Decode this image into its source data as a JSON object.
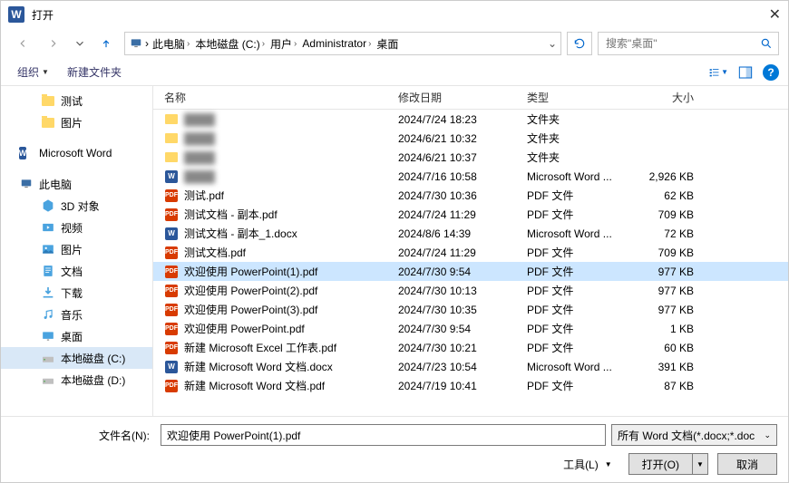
{
  "title": "打开",
  "breadcrumbs": [
    "此电脑",
    "本地磁盘 (C:)",
    "用户",
    "Administrator",
    "桌面"
  ],
  "search_placeholder": "搜索\"桌面\"",
  "toolbar": {
    "organize": "组织",
    "newfolder": "新建文件夹"
  },
  "nav": {
    "quick": [
      {
        "label": "测试",
        "icon": "folder"
      },
      {
        "label": "图片",
        "icon": "folder"
      }
    ],
    "word": "Microsoft Word",
    "thispc": "此电脑",
    "thispc_children": [
      {
        "label": "3D 对象",
        "icon": "3d"
      },
      {
        "label": "视频",
        "icon": "video"
      },
      {
        "label": "图片",
        "icon": "pictures"
      },
      {
        "label": "文档",
        "icon": "docs"
      },
      {
        "label": "下载",
        "icon": "downloads"
      },
      {
        "label": "音乐",
        "icon": "music"
      },
      {
        "label": "桌面",
        "icon": "desktop"
      }
    ],
    "drives": [
      {
        "label": "本地磁盘 (C:)",
        "selected": true
      },
      {
        "label": "本地磁盘 (D:)",
        "selected": false
      }
    ]
  },
  "columns": {
    "name": "名称",
    "date": "修改日期",
    "type": "类型",
    "size": "大小"
  },
  "files": [
    {
      "name": "",
      "date": "2024/7/24 18:23",
      "type": "文件夹",
      "size": "",
      "icon": "folder",
      "blurred": true
    },
    {
      "name": "",
      "date": "2024/6/21 10:32",
      "type": "文件夹",
      "size": "",
      "icon": "folder",
      "blurred": true
    },
    {
      "name": "",
      "date": "2024/6/21 10:37",
      "type": "文件夹",
      "size": "",
      "icon": "folder",
      "blurred": true
    },
    {
      "name": "",
      "date": "2024/7/16 10:58",
      "type": "Microsoft Word ...",
      "size": "2,926 KB",
      "icon": "docx",
      "blurred": true
    },
    {
      "name": "测试.pdf",
      "date": "2024/7/30 10:36",
      "type": "PDF 文件",
      "size": "62 KB",
      "icon": "pdf"
    },
    {
      "name": "测试文档 - 副本.pdf",
      "date": "2024/7/24 11:29",
      "type": "PDF 文件",
      "size": "709 KB",
      "icon": "pdf"
    },
    {
      "name": "测试文档 - 副本_1.docx",
      "date": "2024/8/6 14:39",
      "type": "Microsoft Word ...",
      "size": "72 KB",
      "icon": "docx"
    },
    {
      "name": "测试文档.pdf",
      "date": "2024/7/24 11:29",
      "type": "PDF 文件",
      "size": "709 KB",
      "icon": "pdf"
    },
    {
      "name": "欢迎使用 PowerPoint(1).pdf",
      "date": "2024/7/30 9:54",
      "type": "PDF 文件",
      "size": "977 KB",
      "icon": "pdf",
      "selected": true
    },
    {
      "name": "欢迎使用 PowerPoint(2).pdf",
      "date": "2024/7/30 10:13",
      "type": "PDF 文件",
      "size": "977 KB",
      "icon": "pdf"
    },
    {
      "name": "欢迎使用 PowerPoint(3).pdf",
      "date": "2024/7/30 10:35",
      "type": "PDF 文件",
      "size": "977 KB",
      "icon": "pdf"
    },
    {
      "name": "欢迎使用 PowerPoint.pdf",
      "date": "2024/7/30 9:54",
      "type": "PDF 文件",
      "size": "1 KB",
      "icon": "pdf"
    },
    {
      "name": "新建 Microsoft Excel 工作表.pdf",
      "date": "2024/7/30 10:21",
      "type": "PDF 文件",
      "size": "60 KB",
      "icon": "pdf"
    },
    {
      "name": "新建 Microsoft Word 文档.docx",
      "date": "2024/7/23 10:54",
      "type": "Microsoft Word ...",
      "size": "391 KB",
      "icon": "docx"
    },
    {
      "name": "新建 Microsoft Word 文档.pdf",
      "date": "2024/7/19 10:41",
      "type": "PDF 文件",
      "size": "87 KB",
      "icon": "pdf"
    }
  ],
  "filename_label": "文件名(N):",
  "filename_value": "欢迎使用 PowerPoint(1).pdf",
  "filter": "所有 Word 文档(*.docx;*.doc",
  "tools_label": "工具(L)",
  "open_label": "打开(O)",
  "cancel_label": "取消"
}
